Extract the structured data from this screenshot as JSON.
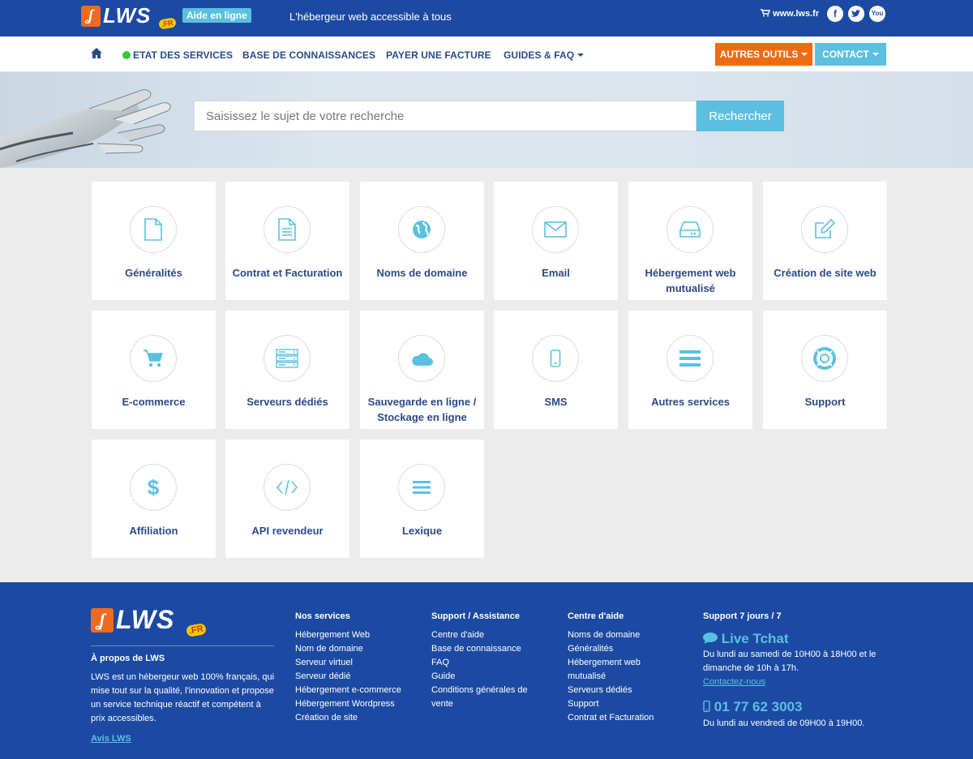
{
  "header": {
    "logo_text": "LWS",
    "logo_fr": ".FR",
    "aide_badge": "Aide en ligne",
    "tagline": "L'hébergeur web accessible à tous",
    "cart_link": "www.lws.fr",
    "social": [
      "f",
      "t",
      "yt"
    ]
  },
  "nav": {
    "items": [
      "ETAT DES SERVICES",
      "BASE DE CONNAISSANCES",
      "PAYER UNE FACTURE",
      "GUIDES & FAQ"
    ],
    "tools": "AUTRES OUTILS",
    "contact": "CONTACT"
  },
  "search": {
    "placeholder": "Saisissez le sujet de votre recherche",
    "button": "Rechercher"
  },
  "categories": [
    {
      "label": "Généralités",
      "icon": "file-icon"
    },
    {
      "label": "Contrat et Facturation",
      "icon": "file-text-icon"
    },
    {
      "label": "Noms de domaine",
      "icon": "globe-icon"
    },
    {
      "label": "Email",
      "icon": "envelope-icon"
    },
    {
      "label": "Hébergement web mutualisé",
      "icon": "server-drive-icon"
    },
    {
      "label": "Création de site web",
      "icon": "edit-icon"
    },
    {
      "label": "E-commerce",
      "icon": "cart-icon"
    },
    {
      "label": "Serveurs dédiés",
      "icon": "server-rack-icon"
    },
    {
      "label": "Sauvegarde en ligne / Stockage en ligne",
      "icon": "cloud-icon"
    },
    {
      "label": "SMS",
      "icon": "mobile-icon"
    },
    {
      "label": "Autres services",
      "icon": "list-icon"
    },
    {
      "label": "Support",
      "icon": "lifebuoy-icon"
    },
    {
      "label": "Affiliation",
      "icon": "dollar-icon"
    },
    {
      "label": "API revendeur",
      "icon": "code-icon"
    },
    {
      "label": "Lexique",
      "icon": "menu-icon"
    }
  ],
  "footer": {
    "about_title": "À propos de LWS",
    "about_text": "LWS est un hébergeur web 100% français, qui mise tout sur la qualité, l'innovation et propose un service technique réactif et compétent à prix accessibles.",
    "about_link": "Avis LWS",
    "services_title": "Nos services",
    "services": [
      "Hébergement Web",
      "Nom de domaine",
      "Serveur virtuel",
      "Serveur dédié",
      "Hébergement e-commerce",
      "Hébergement Wordpress",
      "Création de site"
    ],
    "support_title": "Support / Assistance",
    "support": [
      "Centre d'aide",
      "Base de connaissance",
      "FAQ",
      "Guide",
      "Conditions générales de vente"
    ],
    "help_title": "Centre d'aide",
    "help": [
      "Noms de domaine",
      "Généralités",
      "Hébergement web mutualisé",
      "Serveurs dédiés",
      "Support",
      "Contrat et Facturation"
    ],
    "support7_title": "Support 7 jours / 7",
    "live_tchat": "Live Tchat",
    "tchat_hours": "Du lundi au samedi de 10H00 à 18H00 et le dimanche de 10h à 17h.",
    "contact_link": "Contactez-nous",
    "phone": "01 77 62 3003",
    "phone_hours": "Du lundi au vendredi de 09H00 à 19H00."
  },
  "colors": {
    "primary": "#1c4aa3",
    "accent": "#5bc0e0",
    "orange": "#f26a10",
    "icon": "#5bc0e0"
  }
}
